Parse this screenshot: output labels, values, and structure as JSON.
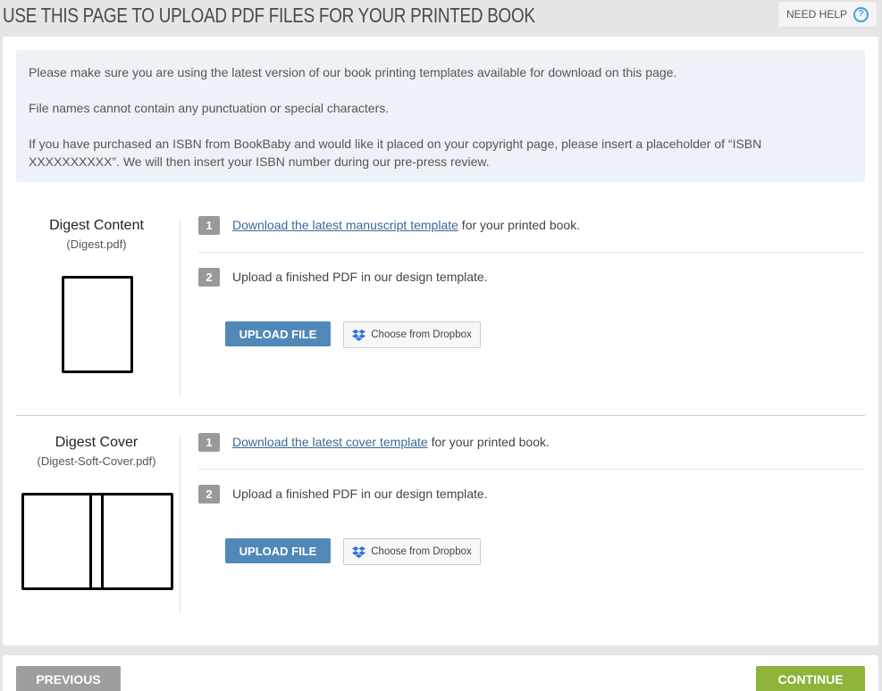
{
  "header": {
    "title": "USE THIS PAGE TO UPLOAD PDF FILES FOR YOUR PRINTED BOOK",
    "need_help_label": "NEED HELP",
    "help_icon": "question-circle-icon"
  },
  "notice": {
    "line1": "Please make sure you are using the latest version of our book printing templates available for download on this page.",
    "line2": "File names cannot contain any punctuation or special characters.",
    "line3": "If you have purchased an ISBN from BookBaby and would like it placed on your copyright page, please insert a placeholder of “ISBN XXXXXXXXXX”. We will then insert your ISBN number during our pre-press review."
  },
  "sections": [
    {
      "name": "Digest Content",
      "file": "(Digest.pdf)",
      "step1_num": "1",
      "step1_link": "Download the latest manuscript template",
      "step1_suffix": " for your printed book.",
      "step2_num": "2",
      "step2_text": "Upload a finished PDF in our design template.",
      "upload_label": "UPLOAD FILE",
      "dropbox_label": "Choose from Dropbox"
    },
    {
      "name": "Digest Cover",
      "file": "(Digest-Soft-Cover.pdf)",
      "step1_num": "1",
      "step1_link": "Download the latest cover template",
      "step1_suffix": " for your printed book.",
      "step2_num": "2",
      "step2_text": "Upload a finished PDF in our design template.",
      "upload_label": "UPLOAD FILE",
      "dropbox_label": "Choose from Dropbox"
    }
  ],
  "footer": {
    "previous_label": "PREVIOUS",
    "continue_label": "CONTINUE"
  },
  "colors": {
    "upload_button": "#5089b8",
    "continue_button": "#8db33a",
    "previous_button": "#9e9e9e",
    "notice_background": "#edf2f9",
    "link": "#3b6a96",
    "help_accent": "#3ea3dc"
  }
}
